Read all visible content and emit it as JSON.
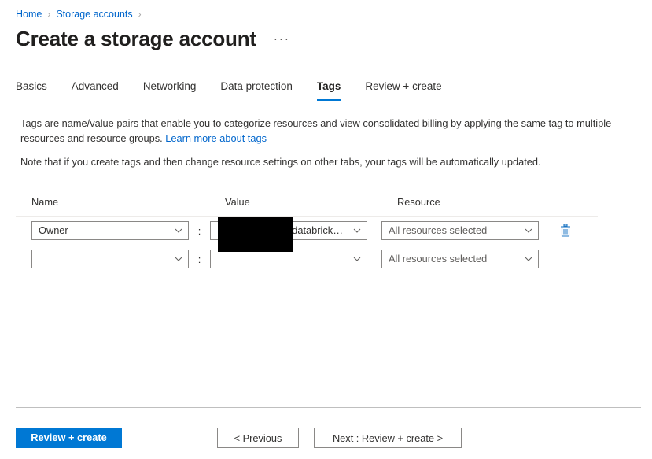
{
  "breadcrumb": {
    "items": [
      {
        "label": "Home"
      },
      {
        "label": "Storage accounts"
      }
    ],
    "separator": "›",
    "trailing_separator": "›"
  },
  "header": {
    "title": "Create a storage account",
    "overflow_menu": "···",
    "overflow_icon_name": "more-menu-icon"
  },
  "tabs": [
    {
      "label": "Basics",
      "active": false
    },
    {
      "label": "Advanced",
      "active": false
    },
    {
      "label": "Networking",
      "active": false
    },
    {
      "label": "Data protection",
      "active": false
    },
    {
      "label": "Tags",
      "active": true
    },
    {
      "label": "Review + create",
      "active": false
    }
  ],
  "description": {
    "paragraph_1_part_1": "Tags are name/value pairs that enable you to categorize resources and view consolidated billing by applying the same tag to multiple resources and resource groups. ",
    "learn_more_link": "Learn more about tags",
    "paragraph_2": "Note that if you create tags and then change resource settings on other tabs, your tags will be automatically updated."
  },
  "tag_table": {
    "columns": {
      "name": "Name",
      "value": "Value",
      "resource": "Resource"
    },
    "separator": ":",
    "rows": [
      {
        "name": "Owner",
        "value": "@databrick…",
        "value_redacted": true,
        "resource": "All resources selected",
        "delete_label": "Delete tag",
        "has_delete": true
      },
      {
        "name": "",
        "value": "",
        "value_redacted": false,
        "resource": "All resources selected",
        "delete_label": "",
        "has_delete": false
      }
    ]
  },
  "footer": {
    "review_create": "Review + create",
    "previous": "< Previous",
    "next": "Next : Review + create >"
  },
  "colors": {
    "accent": "#0078d4",
    "link": "#0066cc",
    "text": "#323130",
    "border": "#8a8886",
    "redaction": "#000000"
  }
}
